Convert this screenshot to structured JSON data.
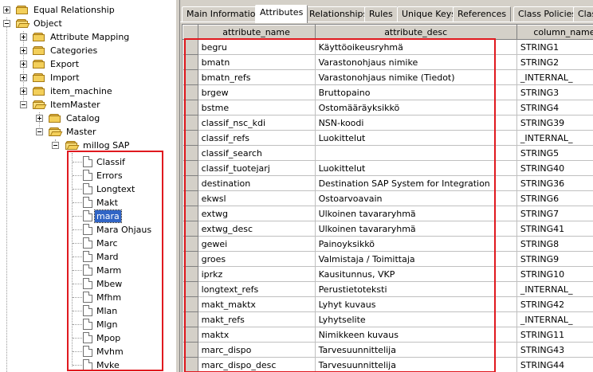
{
  "tree": {
    "nodes": [
      {
        "label": "Equal Relationship",
        "toggle": "plus",
        "icon": "folder",
        "depth": 0
      },
      {
        "label": "Object",
        "toggle": "minus",
        "icon": "folder-open",
        "depth": 0
      },
      {
        "label": "Attribute Mapping",
        "toggle": "plus",
        "icon": "folder",
        "depth": 1
      },
      {
        "label": "Categories",
        "toggle": "plus",
        "icon": "folder",
        "depth": 1
      },
      {
        "label": "Export",
        "toggle": "plus",
        "icon": "folder",
        "depth": 1
      },
      {
        "label": "Import",
        "toggle": "plus",
        "icon": "folder",
        "depth": 1
      },
      {
        "label": "item_machine",
        "toggle": "plus",
        "icon": "folder",
        "depth": 1
      },
      {
        "label": "ItemMaster",
        "toggle": "minus",
        "icon": "folder-open",
        "depth": 1
      },
      {
        "label": "Catalog",
        "toggle": "plus",
        "icon": "folder",
        "depth": 2
      },
      {
        "label": "Master",
        "toggle": "minus",
        "icon": "folder-open",
        "depth": 2
      },
      {
        "label": "millog SAP",
        "toggle": "minus",
        "icon": "folder-open",
        "depth": 3
      }
    ],
    "classes": [
      "Classif",
      "Errors",
      "Longtext",
      "Makt",
      "mara",
      "Mara Ohjaus",
      "Marc",
      "Mard",
      "Marm",
      "Mbew",
      "Mfhm",
      "Mlan",
      "Mlgn",
      "Mpop",
      "Mvhm",
      "Mvke"
    ],
    "selected_class": "mara"
  },
  "tabs": [
    {
      "label": "Main Information",
      "active": false
    },
    {
      "label": "Attributes",
      "active": true
    },
    {
      "label": "Relationships",
      "active": false
    },
    {
      "label": "Rules",
      "active": false
    },
    {
      "label": "Unique Keys",
      "active": false
    },
    {
      "label": "References",
      "active": false
    },
    {
      "label": "Class Policies",
      "active": false
    },
    {
      "label": "Class",
      "active": false
    }
  ],
  "grid": {
    "columns": [
      "attribute_name",
      "attribute_desc",
      "column_name"
    ],
    "rows": [
      [
        "begru",
        "Käyttöoikeusryhmä",
        "STRING1"
      ],
      [
        "bmatn",
        "Varastonohjaus nimike",
        "STRING2"
      ],
      [
        "bmatn_refs",
        "Varastonohjaus nimike (Tiedot)",
        "_INTERNAL_"
      ],
      [
        "brgew",
        "Bruttopaino",
        "STRING3"
      ],
      [
        "bstme",
        "Ostomääräyksikkö",
        "STRING4"
      ],
      [
        "classif_nsc_kdi",
        "NSN-koodi",
        "STRING39"
      ],
      [
        "classif_refs",
        "Luokittelut",
        "_INTERNAL_"
      ],
      [
        "classif_search",
        "",
        "STRING5"
      ],
      [
        "classif_tuotejarj",
        "Luokittelut",
        "STRING40"
      ],
      [
        "destination",
        "Destination SAP System for Integration",
        "STRING36"
      ],
      [
        "ekwsl",
        "Ostoarvoavain",
        "STRING6"
      ],
      [
        "extwg",
        "Ulkoinen tavararyhmä",
        "STRING7"
      ],
      [
        "extwg_desc",
        "Ulkoinen tavararyhmä",
        "STRING41"
      ],
      [
        "gewei",
        "Painoyksikkö",
        "STRING8"
      ],
      [
        "groes",
        "Valmistaja / Toimittaja",
        "STRING9"
      ],
      [
        "iprkz",
        "Kausitunnus, VKP",
        "STRING10"
      ],
      [
        "longtext_refs",
        "Perustietoteksti",
        "_INTERNAL_"
      ],
      [
        "makt_maktx",
        "Lyhyt kuvaus",
        "STRING42"
      ],
      [
        "makt_refs",
        "Lyhytselite",
        "_INTERNAL_"
      ],
      [
        "maktx",
        "Nimikkeen kuvaus",
        "STRING11"
      ],
      [
        "marc_dispo",
        "Tarvesuunnittelija",
        "STRING43"
      ],
      [
        "marc_dispo_desc",
        "Tarvesuunnittelija",
        "STRING44"
      ]
    ]
  },
  "colors": {
    "highlight_box": "#e0191f",
    "selection": "#3165c5",
    "chrome": "#d4d0c8"
  }
}
